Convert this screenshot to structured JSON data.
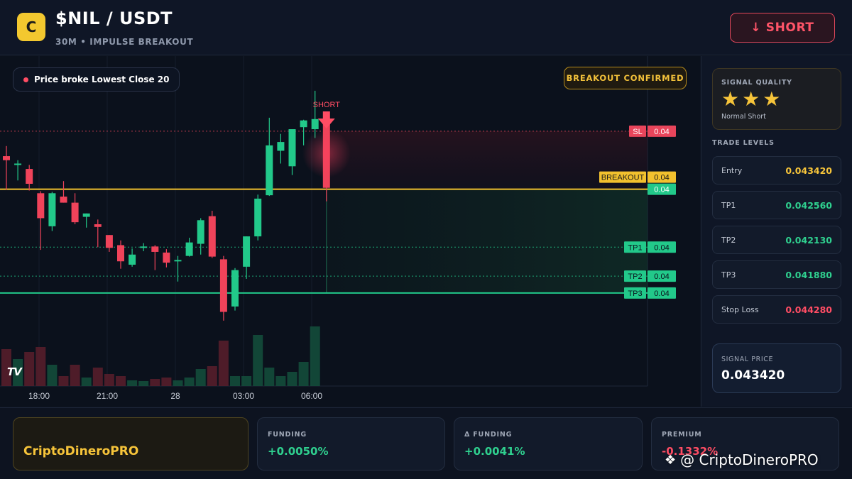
{
  "header": {
    "coin_letter": "C",
    "pair": "$NIL / USDT",
    "subtitle": "30M • IMPULSE BREAKOUT",
    "signal_button": "↓ SHORT"
  },
  "chart": {
    "info_label": "Price broke Lowest Close 20",
    "breakout_badge": "BREAKOUT CONFIRMED",
    "short_marker": "SHORT",
    "tv_logo": "TV",
    "x_labels": [
      "18:00",
      "21:00",
      "28",
      "03:00",
      "06:00"
    ],
    "level_tags": [
      {
        "label": "SL",
        "value": "0.04"
      },
      {
        "label": "BREAKOUT",
        "value": "0.04"
      },
      {
        "label": "",
        "value": "0.04"
      },
      {
        "label": "TP1",
        "value": "0.04"
      },
      {
        "label": "TP2",
        "value": "0.04"
      },
      {
        "label": "TP3",
        "value": "0.04"
      }
    ],
    "colors": {
      "up": "#22c98a",
      "down": "#f0435a",
      "breakout": "#f2c12e",
      "sl": "#e8455b"
    }
  },
  "chart_data": {
    "type": "candlestick",
    "price_levels": {
      "sl": 0.04428,
      "breakout": 0.04342,
      "entry": 0.04342,
      "tp1": 0.04256,
      "tp2": 0.04213,
      "tp3": 0.04188
    },
    "candles": [
      {
        "o": 0.04391,
        "h": 0.04406,
        "l": 0.04341,
        "c": 0.04385
      },
      {
        "o": 0.0438,
        "h": 0.04385,
        "l": 0.04355,
        "c": 0.0438
      },
      {
        "o": 0.04372,
        "h": 0.04378,
        "l": 0.0434,
        "c": 0.0435
      },
      {
        "o": 0.04336,
        "h": 0.04339,
        "l": 0.04252,
        "c": 0.04299
      },
      {
        "o": 0.04287,
        "h": 0.04338,
        "l": 0.0428,
        "c": 0.04336
      },
      {
        "o": 0.04331,
        "h": 0.04354,
        "l": 0.04322,
        "c": 0.04322
      },
      {
        "o": 0.04322,
        "h": 0.04336,
        "l": 0.0429,
        "c": 0.04293
      },
      {
        "o": 0.04301,
        "h": 0.04306,
        "l": 0.04285,
        "c": 0.04306
      },
      {
        "o": 0.0429,
        "h": 0.04297,
        "l": 0.04256,
        "c": 0.04286
      },
      {
        "o": 0.04274,
        "h": 0.04274,
        "l": 0.04249,
        "c": 0.04255
      },
      {
        "o": 0.04259,
        "h": 0.04266,
        "l": 0.04224,
        "c": 0.04235
      },
      {
        "o": 0.0423,
        "h": 0.04254,
        "l": 0.04227,
        "c": 0.04245
      },
      {
        "o": 0.04255,
        "h": 0.04262,
        "l": 0.0425,
        "c": 0.04257
      },
      {
        "o": 0.04257,
        "h": 0.04259,
        "l": 0.04222,
        "c": 0.04249
      },
      {
        "o": 0.04248,
        "h": 0.04253,
        "l": 0.04226,
        "c": 0.04233
      },
      {
        "o": 0.04237,
        "h": 0.04243,
        "l": 0.04205,
        "c": 0.04237
      },
      {
        "o": 0.04243,
        "h": 0.0427,
        "l": 0.04242,
        "c": 0.04263
      },
      {
        "o": 0.04261,
        "h": 0.04299,
        "l": 0.04245,
        "c": 0.04296
      },
      {
        "o": 0.04302,
        "h": 0.0431,
        "l": 0.0424,
        "c": 0.04242
      },
      {
        "o": 0.04238,
        "h": 0.04243,
        "l": 0.04147,
        "c": 0.0416
      },
      {
        "o": 0.04168,
        "h": 0.04225,
        "l": 0.04162,
        "c": 0.04222
      },
      {
        "o": 0.04227,
        "h": 0.04272,
        "l": 0.04209,
        "c": 0.04272
      },
      {
        "o": 0.04272,
        "h": 0.04334,
        "l": 0.04266,
        "c": 0.04328
      },
      {
        "o": 0.04333,
        "h": 0.04448,
        "l": 0.04332,
        "c": 0.04407
      },
      {
        "o": 0.04399,
        "h": 0.04424,
        "l": 0.0438,
        "c": 0.04412
      },
      {
        "o": 0.04376,
        "h": 0.04413,
        "l": 0.04363,
        "c": 0.04431
      },
      {
        "o": 0.04434,
        "h": 0.04445,
        "l": 0.04407,
        "c": 0.04444
      },
      {
        "o": 0.04431,
        "h": 0.04488,
        "l": 0.04418,
        "c": 0.04446
      },
      {
        "o": 0.04444,
        "h": 0.04444,
        "l": 0.04324,
        "c": 0.04344
      }
    ],
    "volumes": [
      52,
      38,
      48,
      55,
      30,
      14,
      30,
      12,
      26,
      17,
      14,
      8,
      7,
      10,
      12,
      8,
      12,
      24,
      28,
      64,
      14,
      14,
      72,
      26,
      14,
      20,
      34,
      84
    ]
  },
  "panel": {
    "quality_title": "SIGNAL QUALITY",
    "stars": "★★★",
    "quality_sub": "Normal Short",
    "levels_title": "TRADE LEVELS",
    "levels": [
      {
        "name": "Entry",
        "value": "0.043420",
        "color": "#f6c43a"
      },
      {
        "name": "TP1",
        "value": "0.042560",
        "color": "#2fd08f"
      },
      {
        "name": "TP2",
        "value": "0.042130",
        "color": "#2fd08f"
      },
      {
        "name": "TP3",
        "value": "0.041880",
        "color": "#2fd08f"
      },
      {
        "name": "Stop Loss",
        "value": "0.044280",
        "color": "#ff4d64"
      }
    ],
    "signal_price_title": "SIGNAL PRICE",
    "signal_price": "0.043420"
  },
  "footer": {
    "brand": "CriptoDineroPRO",
    "funding_label": "FUNDING",
    "funding_value": "+0.0050%",
    "dfunding_label": "Δ FUNDING",
    "dfunding_value": "+0.0041%",
    "premium_label": "PREMIUM",
    "premium_value": "-0.1332%",
    "watermark": "@ CriptoDineroPRO"
  }
}
